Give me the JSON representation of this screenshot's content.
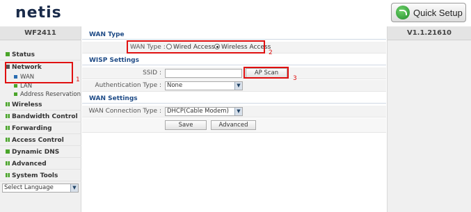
{
  "header": {
    "logo": "netis",
    "quick_setup": "Quick Setup"
  },
  "sidebar": {
    "model": "WF2411",
    "items": [
      {
        "label": "Status"
      },
      {
        "label": "Network"
      },
      {
        "label": "Wireless"
      },
      {
        "label": "Bandwidth Control"
      },
      {
        "label": "Forwarding"
      },
      {
        "label": "Access Control"
      },
      {
        "label": "Dynamic DNS"
      },
      {
        "label": "Advanced"
      },
      {
        "label": "System Tools"
      }
    ],
    "network_sub": [
      {
        "label": "WAN"
      },
      {
        "label": "LAN"
      },
      {
        "label": "Address Reservation"
      }
    ],
    "language": "Select Language"
  },
  "main": {
    "wan_type_title": "WAN Type",
    "wan_type_label": "WAN Type :",
    "wired": "Wired Access",
    "wireless": "Wireless Access",
    "wisp_title": "WISP Settings",
    "ssid_label": "SSID :",
    "ssid_value": "",
    "ap_scan": "AP Scan",
    "auth_label": "Authentication Type :",
    "auth_value": "None",
    "wan_settings_title": "WAN Settings",
    "conn_label": "WAN Connection Type :",
    "conn_value": "DHCP(Cable Modem)",
    "save": "Save",
    "advanced": "Advanced"
  },
  "annotations": {
    "n1": "1",
    "n2": "2",
    "n3": "3"
  },
  "version": "V1.1.21610"
}
